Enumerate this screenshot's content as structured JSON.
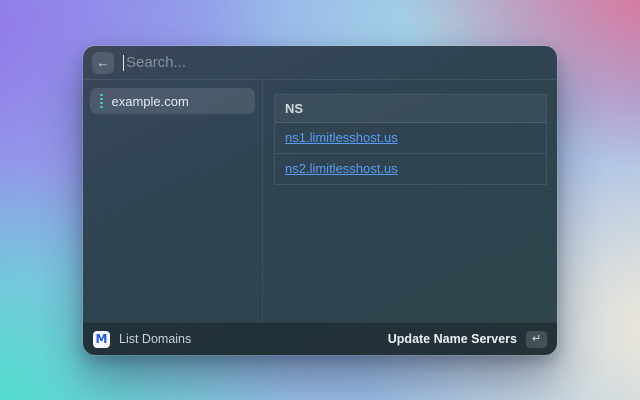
{
  "colors": {
    "accent_teal": "#3fd4b8",
    "link_blue": "#5b9cf6"
  },
  "icons": {
    "back": "←",
    "enter": "↵",
    "logo_letter": "M",
    "grip": "vertical-dots"
  },
  "window": {
    "search": {
      "placeholder": "Search..."
    },
    "sidebar": {
      "items": [
        {
          "label": "example.com",
          "selected": true
        }
      ]
    },
    "table": {
      "header": "NS",
      "rows": [
        "ns1.limitlesshost.us",
        "ns2.limitlesshost.us"
      ]
    },
    "footer": {
      "app_label": "List Domains",
      "primary_action": "Update Name Servers"
    }
  }
}
